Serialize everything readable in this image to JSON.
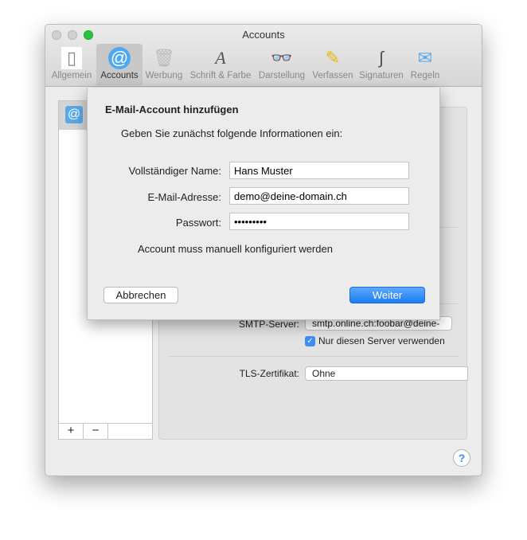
{
  "window": {
    "title": "Accounts"
  },
  "toolbar": [
    {
      "label": "Allgemein",
      "icon": "switch-icon"
    },
    {
      "label": "Accounts",
      "icon": "at-icon",
      "selected": true
    },
    {
      "label": "Werbung",
      "icon": "trash-icon"
    },
    {
      "label": "Schrift & Farbe",
      "icon": "font-color-icon"
    },
    {
      "label": "Darstellung",
      "icon": "glasses-icon"
    },
    {
      "label": "Verfassen",
      "icon": "pencil-icon"
    },
    {
      "label": "Signaturen",
      "icon": "signature-icon"
    },
    {
      "label": "Regeln",
      "icon": "rules-icon"
    }
  ],
  "list": {
    "add": "+",
    "remove": "−"
  },
  "panel": {
    "smtp_label": "SMTP-Server:",
    "smtp_value": "smtp.online.ch:foobar@deine-",
    "only_server": "Nur diesen Server verwenden",
    "tls_label": "TLS-Zertifikat:",
    "tls_value": "Ohne"
  },
  "sheet": {
    "title": "E-Mail-Account hinzufügen",
    "subtitle": "Geben Sie zunächst folgende Informationen ein:",
    "name_label": "Vollständiger Name:",
    "name_value": "Hans Muster",
    "email_label": "E-Mail-Adresse:",
    "email_value": "demo@deine-domain.ch",
    "password_label": "Passwort:",
    "password_value": "•••••••••",
    "message": "Account muss manuell konfiguriert werden",
    "cancel": "Abbrechen",
    "continue": "Weiter"
  },
  "help": "?",
  "colors": {
    "accent": "#3d8df5"
  }
}
